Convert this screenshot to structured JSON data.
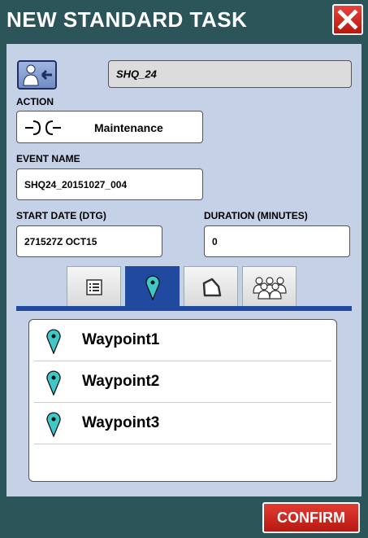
{
  "window": {
    "title": "NEW STANDARD TASK",
    "close_icon": "close-x-icon"
  },
  "assign": {
    "icon": "user-assign-icon",
    "value": "SHQ_24"
  },
  "action": {
    "label": "ACTION",
    "icon": "maintenance-connector-icon",
    "value": "Maintenance"
  },
  "event_name": {
    "label": "EVENT NAME",
    "value": "SHQ24_20151027_004"
  },
  "start_date": {
    "label": "START DATE (DTG)",
    "value": "271527Z OCT15"
  },
  "duration": {
    "label": "DURATION (MINUTES)",
    "value": "0"
  },
  "tabs": [
    {
      "icon": "list-icon",
      "active": false
    },
    {
      "icon": "map-pin-icon",
      "active": true
    },
    {
      "icon": "area-polygon-icon",
      "active": false
    },
    {
      "icon": "group-icon",
      "active": false
    }
  ],
  "waypoints": [
    {
      "icon": "map-pin-icon",
      "label": "Waypoint1"
    },
    {
      "icon": "map-pin-icon",
      "label": "Waypoint2"
    },
    {
      "icon": "map-pin-icon",
      "label": "Waypoint3"
    }
  ],
  "confirm_label": "CONFIRM",
  "colors": {
    "accent": "#1f4a9f",
    "pin": "#3ec9c9",
    "danger": "#c92a20",
    "panel": "#c4d1e6",
    "frame": "#2b5559"
  }
}
